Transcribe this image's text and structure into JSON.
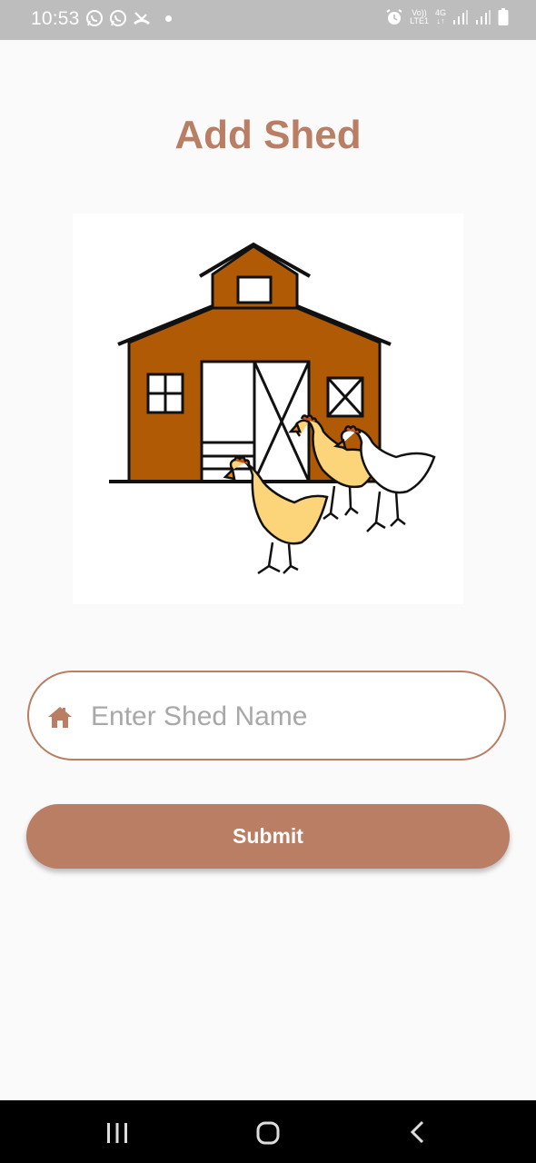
{
  "status_bar": {
    "time": "10:53",
    "network_top": "Vo))",
    "network_bottom": "LTE1",
    "gen_top": "4G",
    "gen_bottom": "↓↑"
  },
  "page": {
    "title": "Add Shed"
  },
  "form": {
    "shed_name_placeholder": "Enter Shed Name",
    "shed_name_value": "",
    "submit_label": "Submit"
  },
  "theme": {
    "accent": "#b97e63",
    "barn_color": "#b05a06",
    "chicken_yellow": "#fcd47a"
  },
  "icons": {
    "input_icon": "home-icon",
    "nav": [
      "recents-icon",
      "home-button-icon",
      "back-icon"
    ]
  }
}
